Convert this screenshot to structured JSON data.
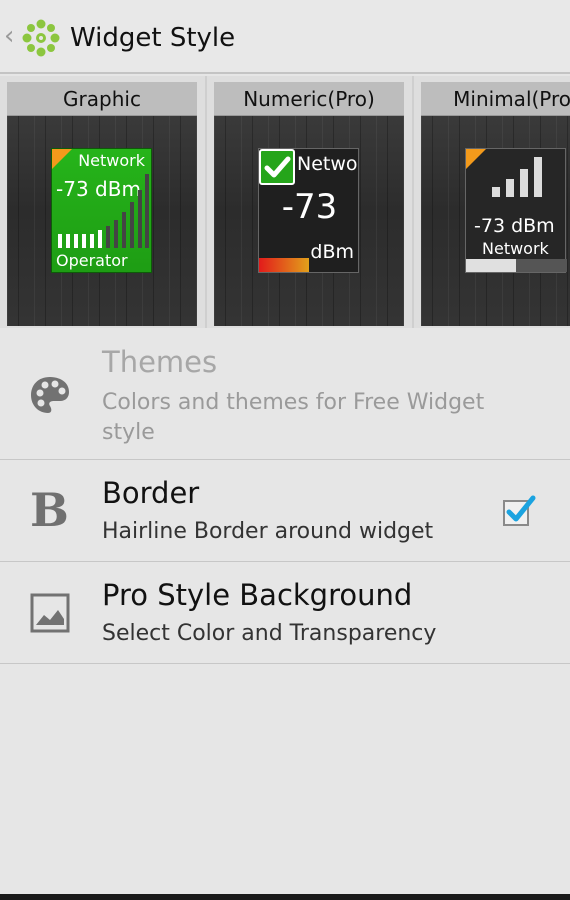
{
  "action_bar": {
    "title": "Widget Style",
    "back": "‹"
  },
  "styles": [
    {
      "label": "Graphic",
      "network": "Network",
      "dbm": "-73 dBm",
      "operator": "Operator"
    },
    {
      "label": "Numeric(Pro)",
      "network": "Netwo...",
      "value": "-73",
      "unit": "dBm"
    },
    {
      "label": "Minimal(Pro)",
      "dbm": "-73 dBm",
      "network": "Network"
    }
  ],
  "preferences": {
    "themes": {
      "title": "Themes",
      "summary": "Colors and themes for Free Widget style",
      "icon": "palette-icon",
      "enabled": false
    },
    "border": {
      "title": "Border",
      "summary": "Hairline Border around widget",
      "icon": "bold-b-icon",
      "checked": true
    },
    "pro_bg": {
      "title": "Pro Style Background",
      "summary": "Select Color and Transparency",
      "icon": "image-icon"
    }
  },
  "colors": {
    "graphic_green": "#22aa17",
    "corner_orange": "#f39a1b",
    "check_blue": "#1aa3e0"
  }
}
